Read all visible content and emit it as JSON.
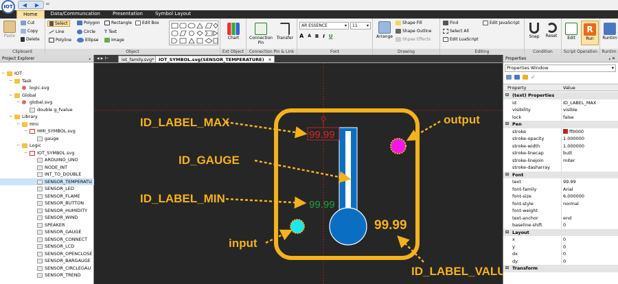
{
  "titlebar": {
    "logo": "IOT",
    "back": "◀",
    "forward": "▶",
    "quick": "="
  },
  "tabs": [
    "Home",
    "Data/Communcation",
    "Presentation",
    "Symbol Layout"
  ],
  "ribbon": {
    "clipboard": {
      "label": "Clipboard",
      "paste": "Paste",
      "cut": "Cut",
      "copy": "Copy",
      "delete": "Delete"
    },
    "object": {
      "label": "Object",
      "select": "Select",
      "line": "Line",
      "polyline": "Polyline",
      "polygon": "Polygon",
      "circle": "Circle",
      "ellipse": "Ellipse",
      "rectangle": "Rectangle",
      "text": "Text",
      "image": "Image",
      "edit_box": "Edit Box"
    },
    "ext_object": {
      "label": "Ext Object",
      "chart": "Chart"
    },
    "connection": {
      "label": "Connection Pin & Link",
      "pin": "Connection Pin",
      "transfer": "Transfer"
    },
    "font": {
      "label": "Font",
      "family": "AR ESSENCE",
      "size": "11",
      "grow": "A",
      "shrink": "A",
      "bold": "B",
      "italic": "I",
      "underline": "U"
    },
    "drawing": {
      "label": "Drawing",
      "arrange": "Arrange",
      "shape_fill": "Shape Fill",
      "shape_outline": "Shape Outline",
      "shape_effects": "Shpae Effects"
    },
    "editing": {
      "label": "Editing",
      "find": "Find",
      "select_all": "Select All",
      "edit_lua": "Edit LuaScript",
      "edit_js": "Edit JavaScript"
    },
    "condition": {
      "label": "Condition",
      "snap": "Snap",
      "reset": "Reset"
    },
    "script": {
      "label": "Script Operation",
      "edit": "Edit",
      "run": "Run"
    },
    "runtime": {
      "label": "Runtim",
      "name": "Runtim"
    }
  },
  "explorer": {
    "title": "Project Explorer",
    "pin": "ᵩ",
    "items": [
      {
        "label": "IOT",
        "depth": 0,
        "kind": "folder",
        "exp": "−"
      },
      {
        "label": "Task",
        "depth": 1,
        "kind": "folder",
        "exp": "−"
      },
      {
        "label": "logic.svg",
        "depth": 2,
        "kind": "dot",
        "exp": ""
      },
      {
        "label": "Global",
        "depth": 1,
        "kind": "folder",
        "exp": "−"
      },
      {
        "label": "global.svg",
        "depth": 2,
        "kind": "dot",
        "exp": "−"
      },
      {
        "label": "double g_fvalue",
        "depth": 3,
        "kind": "comp",
        "exp": ""
      },
      {
        "label": "Library",
        "depth": 1,
        "kind": "folder",
        "exp": "−"
      },
      {
        "label": "Hmi",
        "depth": 2,
        "kind": "folder",
        "exp": "−"
      },
      {
        "label": "HMI_SYMBOL.svg",
        "depth": 3,
        "kind": "svgf",
        "exp": "−"
      },
      {
        "label": "gauge",
        "depth": 4,
        "kind": "comp",
        "exp": ""
      },
      {
        "label": "Logic",
        "depth": 2,
        "kind": "folder",
        "exp": "−"
      },
      {
        "label": "IOT_SYMBOL.svg",
        "depth": 3,
        "kind": "svgf",
        "exp": "−"
      },
      {
        "label": "ARDUINO_UNO",
        "depth": 4,
        "kind": "comp",
        "exp": ""
      },
      {
        "label": "NODE_INT",
        "depth": 4,
        "kind": "comp",
        "exp": ""
      },
      {
        "label": "INT_TO_DOUBLE",
        "depth": 4,
        "kind": "comp",
        "exp": ""
      },
      {
        "label": "SENSOR_TEMPERATU",
        "depth": 4,
        "kind": "comp",
        "exp": "",
        "selected": true
      },
      {
        "label": "SENSOR_LED",
        "depth": 4,
        "kind": "comp",
        "exp": ""
      },
      {
        "label": "SENSOR_FLAME",
        "depth": 4,
        "kind": "comp",
        "exp": ""
      },
      {
        "label": "SENSOR_BUTTON",
        "depth": 4,
        "kind": "comp",
        "exp": ""
      },
      {
        "label": "SENSOR_HUMIDITY",
        "depth": 4,
        "kind": "comp",
        "exp": ""
      },
      {
        "label": "SENSOR_WIND",
        "depth": 4,
        "kind": "comp",
        "exp": ""
      },
      {
        "label": "SPEAKER",
        "depth": 4,
        "kind": "comp",
        "exp": ""
      },
      {
        "label": "SENSOR_GAUGE",
        "depth": 4,
        "kind": "comp",
        "exp": ""
      },
      {
        "label": "SENSOR_CONNECT",
        "depth": 4,
        "kind": "comp",
        "exp": ""
      },
      {
        "label": "SENSOR_LCD",
        "depth": 4,
        "kind": "comp",
        "exp": ""
      },
      {
        "label": "SENSOR_OPENCLOSE",
        "depth": 4,
        "kind": "comp",
        "exp": ""
      },
      {
        "label": "SENSOR_BARGAUGE",
        "depth": 4,
        "kind": "comp",
        "exp": ""
      },
      {
        "label": "SENSOR_CIRCLEGAU",
        "depth": 4,
        "kind": "comp",
        "exp": ""
      },
      {
        "label": "SENSOR_TREND",
        "depth": 4,
        "kind": "comp",
        "exp": ""
      }
    ]
  },
  "doc_tabs": {
    "nav": "◂ ▸ ⊢",
    "tabs": [
      "iot_family.svg*",
      "IOT_SYMBOL.svg(SENSOR_TEMPERATURE)"
    ],
    "close": "✕"
  },
  "canvas": {
    "label_max": "99.99",
    "label_min": "99.99",
    "label_value": "99.99",
    "annotations": {
      "max": "ID_LABEL_MAX",
      "gauge": "ID_GAUGE",
      "min": "ID_LABEL_MIN",
      "input": "input",
      "output": "output",
      "value": "ID_LABEL_VALUE"
    },
    "colors": {
      "frame": "#f5b21c",
      "gauge": "#0a6fc2",
      "max": "#d9262a",
      "min": "#22a040",
      "input": "#18e8f0",
      "output": "#f018e8",
      "annotation": "#f5b21c"
    }
  },
  "properties": {
    "title": "Properties",
    "pin": "ᵩ ✕",
    "window": "Properties Window",
    "col_property": "Property",
    "col_value": "Value",
    "rows": [
      {
        "cat": true,
        "name": "(text) Properties"
      },
      {
        "name": "id",
        "value": "ID_LABEL_MAX"
      },
      {
        "name": "visibility",
        "value": "visible"
      },
      {
        "name": "lock",
        "value": "false"
      },
      {
        "cat": true,
        "name": "Pen"
      },
      {
        "name": "stroke",
        "value": "ff0000",
        "swatch": "#ff0000"
      },
      {
        "name": "stroke-opacity",
        "value": "1.000000"
      },
      {
        "name": "stroke-width",
        "value": "1.000000"
      },
      {
        "name": "stroke-linecap",
        "value": "butt"
      },
      {
        "name": "stroke-linejoin",
        "value": "miter"
      },
      {
        "name": "stroke-dasharray",
        "value": ""
      },
      {
        "cat": true,
        "name": "Font"
      },
      {
        "name": "text",
        "value": "99.99"
      },
      {
        "name": "font-family",
        "value": "Arial"
      },
      {
        "name": "font-size",
        "value": "6.000000"
      },
      {
        "name": "font-style",
        "value": "normal"
      },
      {
        "name": "font-weight",
        "value": ""
      },
      {
        "name": "text-anchor",
        "value": "end"
      },
      {
        "name": "baseline-shift",
        "value": "0"
      },
      {
        "cat": true,
        "name": "Layout"
      },
      {
        "name": "x",
        "value": "0"
      },
      {
        "name": "y",
        "value": "0"
      },
      {
        "name": "dx",
        "value": "0"
      },
      {
        "name": "dy",
        "value": "0"
      },
      {
        "cat": true,
        "name": "Transform"
      }
    ]
  }
}
